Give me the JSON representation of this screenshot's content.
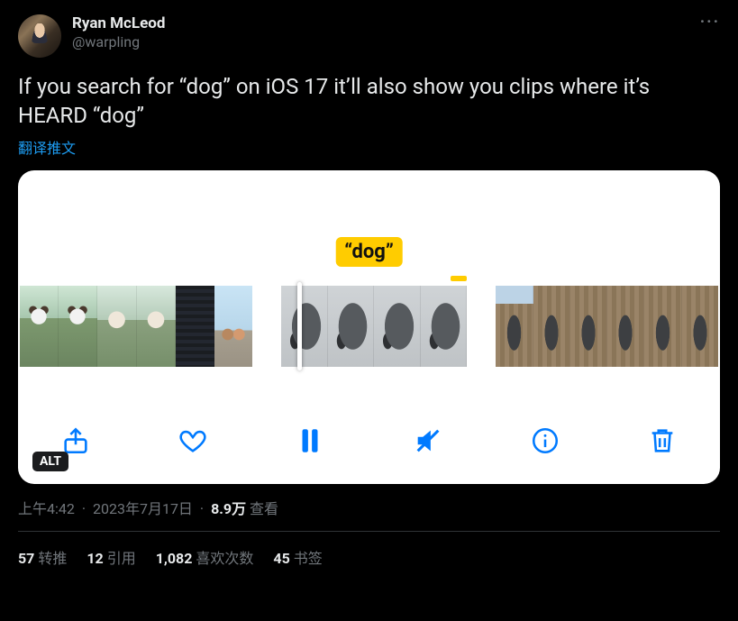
{
  "user": {
    "display_name": "Ryan McLeod",
    "handle": "@warpling"
  },
  "tweet_text": "If you search for “dog” on iOS 17 it’ll also show you clips where it’s HEARD “dog”",
  "translate_label": "翻译推文",
  "media": {
    "search_label": "“dog”",
    "alt_badge": "ALT"
  },
  "meta": {
    "time": "上午4:42",
    "date": "2023年7月17日",
    "views_count": "8.9万",
    "views_label": "查看"
  },
  "stats": {
    "retweets": {
      "count": "57",
      "label": "转推"
    },
    "quotes": {
      "count": "12",
      "label": "引用"
    },
    "likes": {
      "count": "1,082",
      "label": "喜欢次数"
    },
    "bookmarks": {
      "count": "45",
      "label": "书签"
    }
  }
}
